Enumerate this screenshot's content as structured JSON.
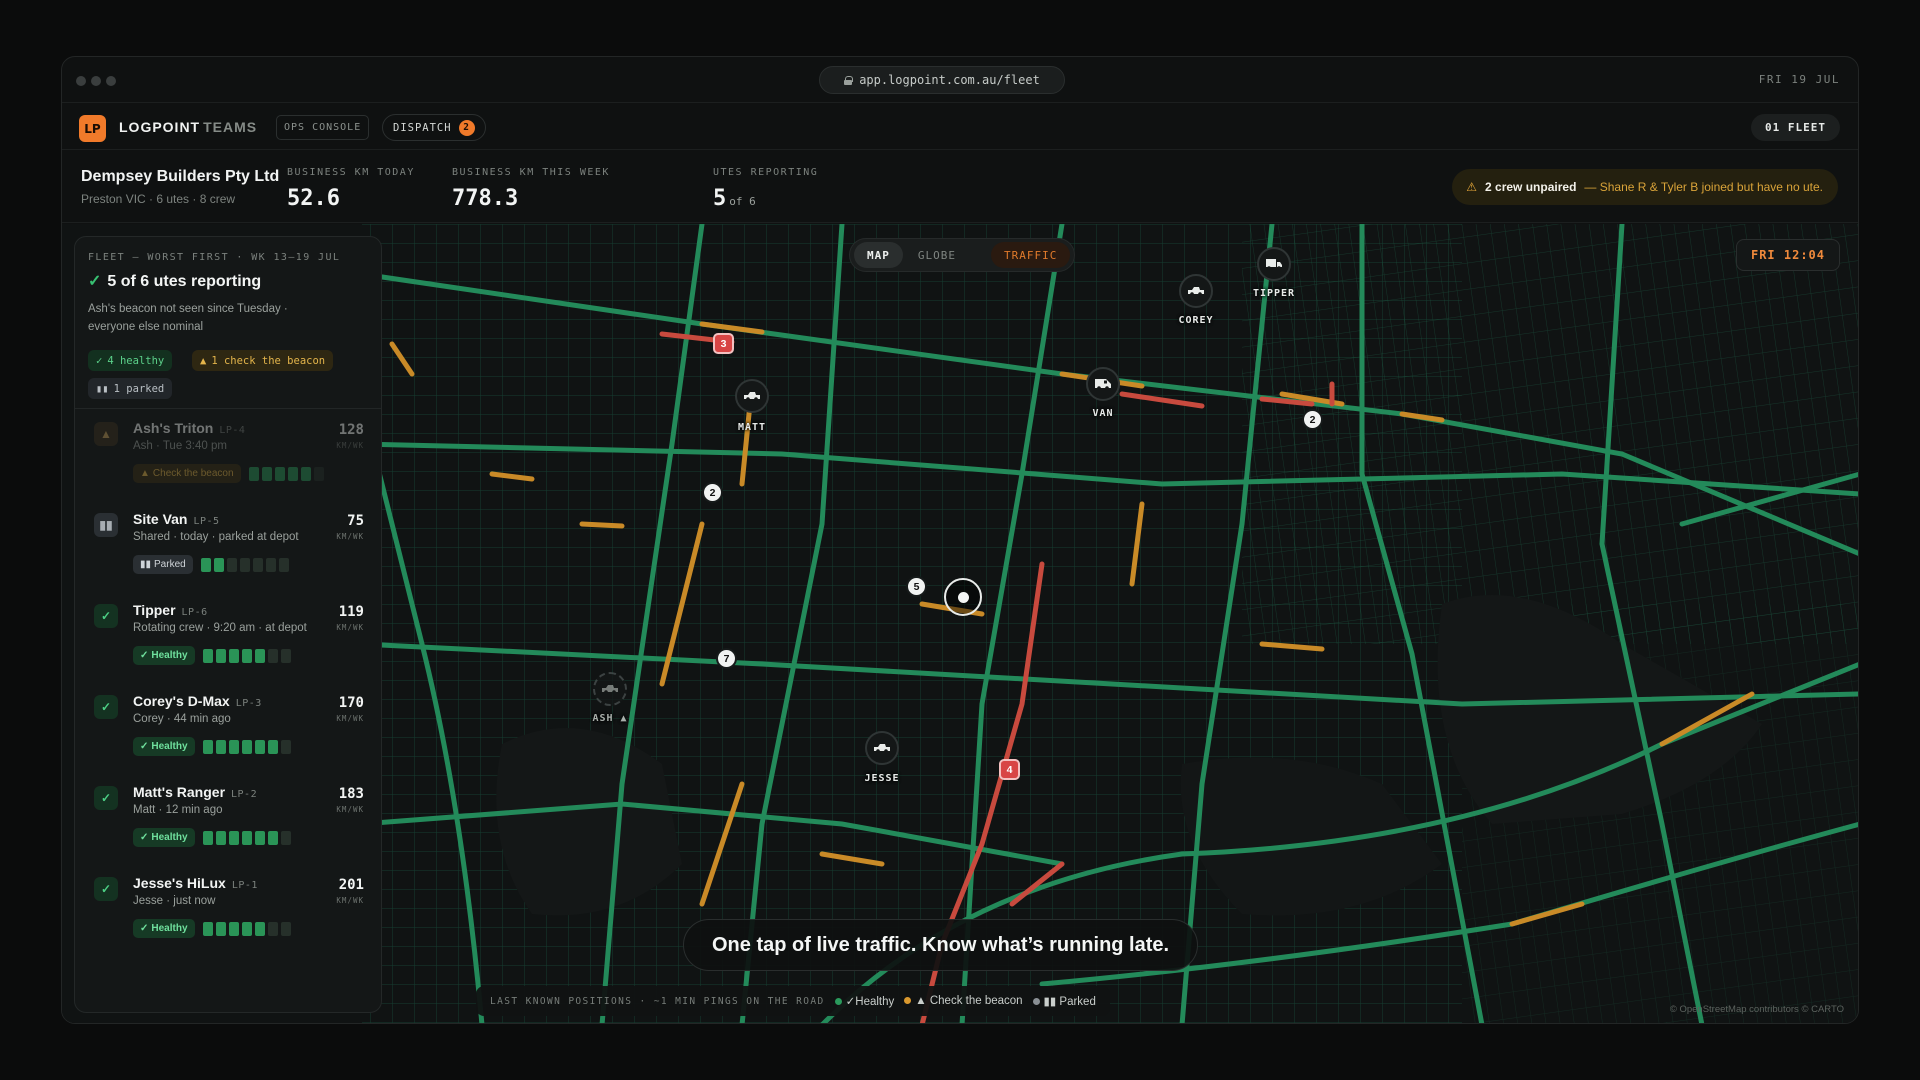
{
  "browser": {
    "url": "app.logpoint.com.au/fleet",
    "date": "FRI 19 JUL"
  },
  "app": {
    "logo": "LP",
    "brand": "LOGPOINT",
    "brand_suffix": "TEAMS",
    "ops_console": "OPS CONSOLE",
    "dispatch": "DISPATCH",
    "dispatch_count": "2",
    "fleet_pill": "01 FLEET"
  },
  "company": {
    "name": "Dempsey Builders Pty Ltd",
    "sub": "Preston VIC · 6 utes · 8 crew"
  },
  "stats": [
    {
      "label": "BUSINESS KM TODAY",
      "value": "52.6"
    },
    {
      "label": "BUSINESS KM THIS WEEK",
      "value": "778.3"
    },
    {
      "label": "UTES REPORTING",
      "value": "5",
      "suffix": "of 6"
    }
  ],
  "alert": {
    "strong": "2 crew unpaired",
    "rest": "— Shane R & Tyler B joined but have no ute."
  },
  "map_controls": {
    "map": "MAP",
    "globe": "GLOBE",
    "traffic": "TRAFFIC",
    "clock": "FRI 12:04"
  },
  "sidebar": {
    "kicker": "FLEET — WORST FIRST · WK 13–19 JUL",
    "title": "5 of 6 utes reporting",
    "desc": "Ash's beacon not seen since Tuesday · everyone else nominal",
    "chips": {
      "healthy": "4 healthy",
      "check": "1 check the beacon",
      "parked": "1 parked"
    },
    "km_unit": "KM/WK",
    "utes": [
      {
        "name": "Ash's Triton",
        "plate": "LP-4",
        "sub": "Ash · Tue 3:40 pm",
        "km": "128",
        "tag": "Check the beacon",
        "status": "check",
        "bars": [
          1,
          1,
          1,
          1,
          1,
          0
        ]
      },
      {
        "name": "Site Van",
        "plate": "LP-5",
        "sub": "Shared · today · parked at depot",
        "km": "75",
        "tag": "Parked",
        "status": "parked",
        "bars": [
          1,
          1,
          0,
          0,
          0,
          0,
          0
        ]
      },
      {
        "name": "Tipper",
        "plate": "LP-6",
        "sub": "Rotating crew · 9:20 am · at depot",
        "km": "119",
        "tag": "Healthy",
        "status": "healthy",
        "bars": [
          1,
          1,
          1,
          1,
          1,
          0,
          0
        ]
      },
      {
        "name": "Corey's D-Max",
        "plate": "LP-3",
        "sub": "Corey · 44 min ago",
        "km": "170",
        "tag": "Healthy",
        "status": "healthy",
        "bars": [
          1,
          1,
          1,
          1,
          1,
          1,
          0
        ]
      },
      {
        "name": "Matt's Ranger",
        "plate": "LP-2",
        "sub": "Matt · 12 min ago",
        "km": "183",
        "tag": "Healthy",
        "status": "healthy",
        "bars": [
          1,
          1,
          1,
          1,
          1,
          1,
          0
        ]
      },
      {
        "name": "Jesse's HiLux",
        "plate": "LP-1",
        "sub": "Jesse · just now",
        "km": "201",
        "tag": "Healthy",
        "status": "healthy",
        "bars": [
          1,
          1,
          1,
          1,
          1,
          0,
          0
        ]
      }
    ]
  },
  "markers": {
    "matt": "MATT",
    "van": "VAN",
    "corey": "COREY",
    "tipper": "TIPPER",
    "jesse": "JESSE",
    "ash": "ASH ▲",
    "nums": [
      "3",
      "2",
      "2",
      "5",
      "7",
      "4"
    ]
  },
  "caption": "One tap of live traffic. Know what’s running late.",
  "legend": {
    "key": "LAST KNOWN POSITIONS · ~1 MIN PINGS ON THE ROAD",
    "healthy": "✓Healthy",
    "check": "▲ Check the beacon",
    "parked": "▮▮ Parked"
  },
  "credit": "© OpenStreetMap contributors © CARTO",
  "colors": {
    "accent": "#f07a2a",
    "healthy": "#2a9a5c",
    "warn": "#d9982e",
    "congested": "#c9433f"
  }
}
